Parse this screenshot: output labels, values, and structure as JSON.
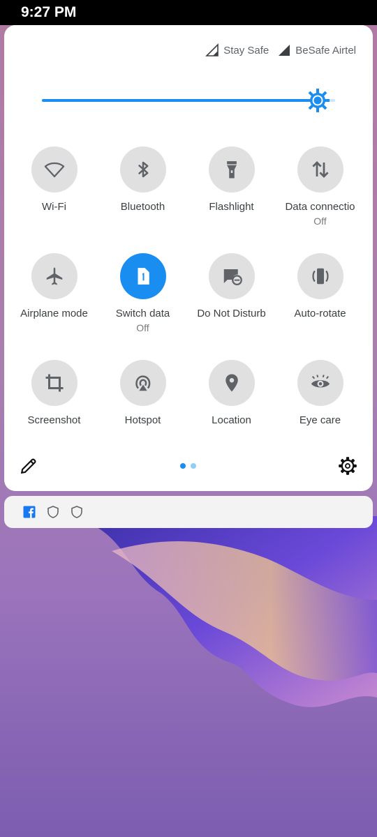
{
  "status_bar": {
    "time": "9:27 PM"
  },
  "carriers": [
    {
      "name": "Stay Safe"
    },
    {
      "name": "BeSafe Airtel"
    }
  ],
  "brightness": {
    "level": 0.94
  },
  "tiles": [
    {
      "label": "Wi-Fi",
      "sub": "",
      "icon": "wifi-icon",
      "active": false
    },
    {
      "label": "Bluetooth",
      "sub": "",
      "icon": "bluetooth-icon",
      "active": false
    },
    {
      "label": "Flashlight",
      "sub": "",
      "icon": "flashlight-icon",
      "active": false
    },
    {
      "label": "Data connectio",
      "sub": "Off",
      "icon": "data-connection-icon",
      "active": false
    },
    {
      "label": "Airplane mode",
      "sub": "",
      "icon": "airplane-icon",
      "active": false
    },
    {
      "label": "Switch data",
      "sub": "Off",
      "icon": "sim-1-icon",
      "active": true
    },
    {
      "label": "Do Not Disturb",
      "sub": "",
      "icon": "do-not-disturb-icon",
      "active": false
    },
    {
      "label": "Auto-rotate",
      "sub": "",
      "icon": "auto-rotate-icon",
      "active": false
    },
    {
      "label": "Screenshot",
      "sub": "",
      "icon": "screenshot-crop-icon",
      "active": false
    },
    {
      "label": "Hotspot",
      "sub": "",
      "icon": "hotspot-icon",
      "active": false
    },
    {
      "label": "Location",
      "sub": "",
      "icon": "location-icon",
      "active": false
    },
    {
      "label": "Eye care",
      "sub": "",
      "icon": "eye-care-icon",
      "active": false
    }
  ],
  "pager": {
    "page_count": 2,
    "current_page": 1
  },
  "colors": {
    "accent": "#1a8ef0",
    "tile_inactive": "#e0e0e0",
    "icon_gray": "#5f6368",
    "dot_inactive": "#8fd0f5"
  },
  "notification_icons": [
    "facebook-icon",
    "shield-icon",
    "shield-icon"
  ]
}
